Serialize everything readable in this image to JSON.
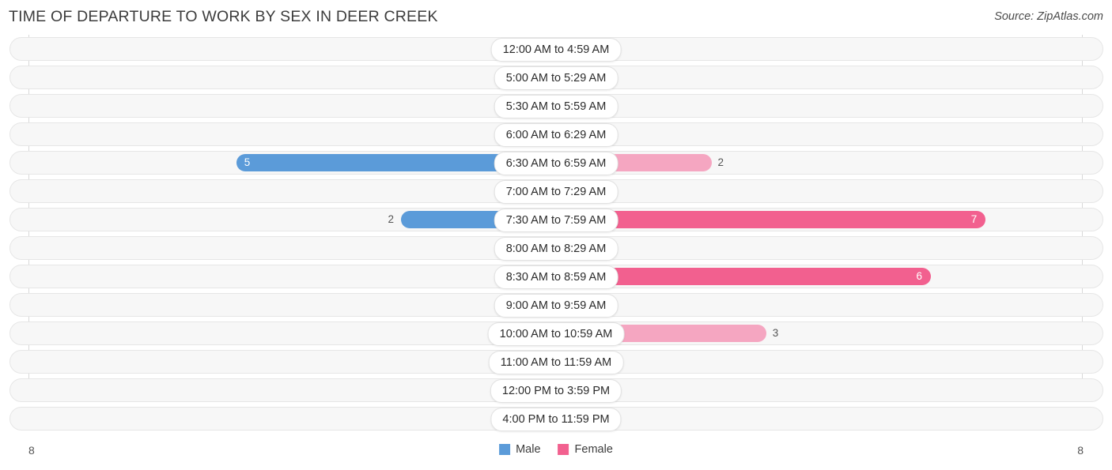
{
  "header": {
    "title": "TIME OF DEPARTURE TO WORK BY SEX IN DEER CREEK",
    "source": "Source: ZipAtlas.com"
  },
  "legend": {
    "male_label": "Male",
    "female_label": "Female",
    "male_color": "#5b9bd9",
    "female_color": "#f2608f"
  },
  "axis": {
    "left_value": "8",
    "right_value": "8"
  },
  "chart_data": {
    "type": "bar",
    "title": "TIME OF DEPARTURE TO WORK BY SEX IN DEER CREEK",
    "orientation": "horizontal-diverging",
    "xlabel": "",
    "ylabel": "",
    "xlim": [
      8,
      8
    ],
    "grid": true,
    "legend_position": "bottom-center",
    "categories": [
      "12:00 AM to 4:59 AM",
      "5:00 AM to 5:29 AM",
      "5:30 AM to 5:59 AM",
      "6:00 AM to 6:29 AM",
      "6:30 AM to 6:59 AM",
      "7:00 AM to 7:29 AM",
      "7:30 AM to 7:59 AM",
      "8:00 AM to 8:29 AM",
      "8:30 AM to 8:59 AM",
      "9:00 AM to 9:59 AM",
      "10:00 AM to 10:59 AM",
      "11:00 AM to 11:59 AM",
      "12:00 PM to 3:59 PM",
      "4:00 PM to 11:59 PM"
    ],
    "series": [
      {
        "name": "Male",
        "values": [
          0,
          0,
          0,
          0,
          5,
          0,
          2,
          0,
          0,
          0,
          0,
          0,
          0,
          0
        ]
      },
      {
        "name": "Female",
        "values": [
          0,
          0,
          0,
          0,
          2,
          0,
          7,
          0,
          6,
          0,
          3,
          0,
          0,
          0
        ]
      }
    ]
  },
  "rows": [
    {
      "label": "12:00 AM to 4:59 AM",
      "male": "0",
      "female": "0"
    },
    {
      "label": "5:00 AM to 5:29 AM",
      "male": "0",
      "female": "0"
    },
    {
      "label": "5:30 AM to 5:59 AM",
      "male": "0",
      "female": "0"
    },
    {
      "label": "6:00 AM to 6:29 AM",
      "male": "0",
      "female": "0"
    },
    {
      "label": "6:30 AM to 6:59 AM",
      "male": "5",
      "female": "2"
    },
    {
      "label": "7:00 AM to 7:29 AM",
      "male": "0",
      "female": "0"
    },
    {
      "label": "7:30 AM to 7:59 AM",
      "male": "2",
      "female": "7"
    },
    {
      "label": "8:00 AM to 8:29 AM",
      "male": "0",
      "female": "0"
    },
    {
      "label": "8:30 AM to 8:59 AM",
      "male": "0",
      "female": "6"
    },
    {
      "label": "9:00 AM to 9:59 AM",
      "male": "0",
      "female": "0"
    },
    {
      "label": "10:00 AM to 10:59 AM",
      "male": "0",
      "female": "3"
    },
    {
      "label": "11:00 AM to 11:59 AM",
      "male": "0",
      "female": "0"
    },
    {
      "label": "12:00 PM to 3:59 PM",
      "male": "0",
      "female": "0"
    },
    {
      "label": "4:00 PM to 11:59 PM",
      "male": "0",
      "female": "0"
    }
  ]
}
